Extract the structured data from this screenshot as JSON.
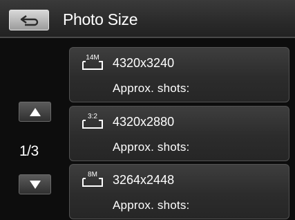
{
  "header": {
    "title": "Photo Size",
    "back_icon": "return-arrow-icon"
  },
  "pager": {
    "page_indicator": "1/3",
    "up_icon": "triangle-up-icon",
    "down_icon": "triangle-down-icon"
  },
  "options": [
    {
      "badge": "14M",
      "resolution": "4320x3240",
      "shots_label": "Approx. shots:",
      "icon": "photo-size-14m-icon"
    },
    {
      "badge": "3:2",
      "resolution": "4320x2880",
      "shots_label": "Approx. shots:",
      "icon": "photo-size-3-2-icon"
    },
    {
      "badge": "8M",
      "resolution": "3264x2448",
      "shots_label": "Approx. shots:",
      "icon": "photo-size-8m-icon"
    }
  ],
  "colors": {
    "background": "#0d0d0d",
    "header": "#2a2a2a",
    "option_card": "#2c2c2c",
    "back_button": "#bdbdbd",
    "text": "#ffffff"
  }
}
